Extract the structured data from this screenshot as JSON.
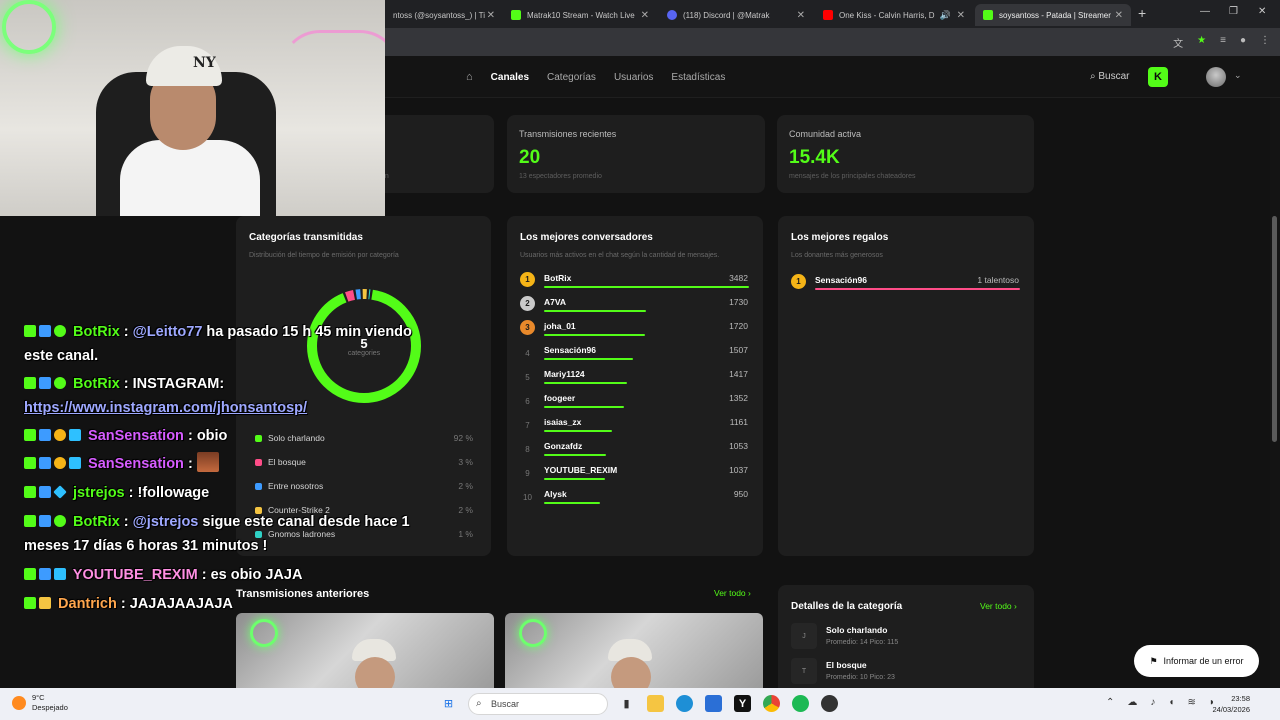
{
  "browser": {
    "tabs": [
      {
        "title": "ntoss (@soysantoss_) | Ti",
        "color": "#888888"
      },
      {
        "title": "Matrak10 Stream - Watch Live",
        "color": "#53fc18"
      },
      {
        "title": "(118) Discord | @Matrak",
        "color": "#5865f2"
      },
      {
        "title": "One Kiss - Calvin Harris, Du",
        "color": "#ff0000"
      },
      {
        "title": "soysantoss - Patada | Streamer",
        "color": "#53fc18"
      }
    ],
    "new_tab": "+",
    "close": "✕",
    "min": "—",
    "max": "❐"
  },
  "nav": {
    "home_icon": "⌂",
    "links": [
      "Canales",
      "Categorías",
      "Usuarios",
      "Estadísticas"
    ],
    "search_label": "Buscar",
    "kick_glyph": "K",
    "caret": "⌄"
  },
  "stats": [
    {
      "label": "Transmisiones recientes",
      "value": "20",
      "sub": "13 espectadores promedio"
    },
    {
      "label": "Comunidad activa",
      "value": "15.4K",
      "sub": "mensajes de los principales chateadores"
    }
  ],
  "stat_partial_sub": "ón",
  "categories_card": {
    "title": "Categorías transmitidas",
    "subtitle": "Distribución del tiempo de emisión por categoría",
    "total": "5",
    "total_label": "categories",
    "items": [
      {
        "name": "Solo charlando",
        "pct": "92 %",
        "value": 92,
        "color": "#53fc18"
      },
      {
        "name": "El bosque",
        "pct": "3 %",
        "value": 3,
        "color": "#ff4d88"
      },
      {
        "name": "Entre nosotros",
        "pct": "2 %",
        "value": 2,
        "color": "#3d9bff"
      },
      {
        "name": "Counter-Strike 2",
        "pct": "2 %",
        "value": 2,
        "color": "#f5c542"
      },
      {
        "name": "Gnomos ladrones",
        "pct": "1 %",
        "value": 1,
        "color": "#2fd1c5"
      }
    ]
  },
  "chatters_card": {
    "title": "Los mejores conversadores",
    "subtitle": "Usuarios más activos en el chat según la cantidad de mensajes.",
    "rows": [
      {
        "rank": "1",
        "name": "BotRix",
        "value": "3482",
        "n": 3482,
        "medal": "#f5b417"
      },
      {
        "rank": "2",
        "name": "A7VA",
        "value": "1730",
        "n": 1730,
        "medal": "#c9c9c9"
      },
      {
        "rank": "3",
        "name": "joha_01",
        "value": "1720",
        "n": 1720,
        "medal": "#e8892b"
      },
      {
        "rank": "4",
        "name": "Sensación96",
        "value": "1507",
        "n": 1507,
        "medal": ""
      },
      {
        "rank": "5",
        "name": "Mariy1124",
        "value": "1417",
        "n": 1417,
        "medal": ""
      },
      {
        "rank": "6",
        "name": "foogeer",
        "value": "1352",
        "n": 1352,
        "medal": ""
      },
      {
        "rank": "7",
        "name": "isaias_zx",
        "value": "1161",
        "n": 1161,
        "medal": ""
      },
      {
        "rank": "8",
        "name": "Gonzafdz",
        "value": "1053",
        "n": 1053,
        "medal": ""
      },
      {
        "rank": "9",
        "name": "YOUTUBE_REXIM",
        "value": "1037",
        "n": 1037,
        "medal": ""
      },
      {
        "rank": "10",
        "name": "Alysk",
        "value": "950",
        "n": 950,
        "medal": ""
      }
    ]
  },
  "gifts_card": {
    "title": "Los mejores regalos",
    "subtitle": "Los donantes más generosos",
    "rows": [
      {
        "rank": "1",
        "name": "Sensación96",
        "value": "1 talentoso"
      }
    ]
  },
  "previous": {
    "title": "Transmisiones anteriores",
    "see_all": "Ver todo ›"
  },
  "details_card": {
    "title": "Detalles de la categoría",
    "see_all": "Ver todo ›",
    "rows": [
      {
        "icon": "J",
        "name": "Solo charlando",
        "meta": "Promedio: 14    Pico: 115"
      },
      {
        "icon": "T",
        "name": "El bosque",
        "meta": "Promedio: 10    Pico: 23"
      }
    ]
  },
  "report_button": "Informar de un error",
  "chat": [
    {
      "user": "BotRix",
      "sep": " : ",
      "parts": [
        {
          "t": "@Leitto77",
          "c": "mention"
        },
        {
          "t": " ha pasado 15 h 45 min viendo",
          "c": ""
        }
      ]
    },
    {
      "cont": "este canal."
    },
    {
      "user": "BotRix",
      "sep": " : ",
      "parts": [
        {
          "t": "INSTAGRAM:",
          "c": ""
        }
      ]
    },
    {
      "cont_link": "https://www.instagram.com/jhonsantosp/"
    },
    {
      "user": "SanSensation",
      "sep": " : ",
      "parts": [
        {
          "t": "obio",
          "c": ""
        }
      ]
    },
    {
      "user": "SanSensation",
      "sep": " : ",
      "parts": []
    },
    {
      "user": "jstrejos",
      "sep": " : ",
      "parts": [
        {
          "t": "!followage",
          "c": ""
        }
      ]
    },
    {
      "user": "BotRix",
      "sep": " : ",
      "parts": [
        {
          "t": "@jstrejos",
          "c": "mention"
        },
        {
          "t": " sigue este canal desde hace 1",
          "c": ""
        }
      ]
    },
    {
      "cont": "meses 17 días 6 horas 31 minutos !"
    },
    {
      "user": "YOUTUBE_REXIM",
      "sep": " : ",
      "parts": [
        {
          "t": "es obio JAJA",
          "c": ""
        }
      ]
    },
    {
      "user": "Dantrich",
      "sep": " : ",
      "parts": [
        {
          "t": "JAJAJAAJAJA",
          "c": ""
        }
      ]
    }
  ],
  "taskbar": {
    "temp": "9°C",
    "weather": "Despejado",
    "search": "Buscar",
    "time": "23:58",
    "date": "24/03/2026"
  }
}
